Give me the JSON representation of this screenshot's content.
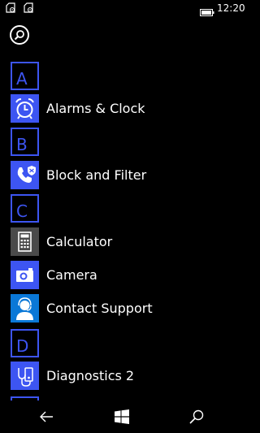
{
  "status_bar": {
    "time": "12:20",
    "icons": [
      "sim-1-icon",
      "sim-2-icon",
      "battery-icon"
    ]
  },
  "colors": {
    "accent": "#3d55f2",
    "background": "#000000",
    "text": "#ffffff"
  },
  "app_list": {
    "sections": [
      {
        "letter": "A",
        "apps": [
          {
            "label": "Alarms & Clock",
            "icon": "alarm-clock-icon"
          }
        ]
      },
      {
        "letter": "B",
        "apps": [
          {
            "label": "Block and Filter",
            "icon": "block-filter-shield-icon"
          }
        ]
      },
      {
        "letter": "C",
        "apps": [
          {
            "label": "Calculator",
            "icon": "calculator-icon"
          },
          {
            "label": "Camera",
            "icon": "camera-icon"
          },
          {
            "label": "Contact Support",
            "icon": "contact-support-icon"
          }
        ]
      },
      {
        "letter": "D",
        "apps": [
          {
            "label": "Diagnostics 2",
            "icon": "diagnostics-icon"
          }
        ]
      }
    ]
  },
  "nav_bar": {
    "buttons": [
      "back-icon",
      "windows-home-icon",
      "search-icon"
    ]
  }
}
